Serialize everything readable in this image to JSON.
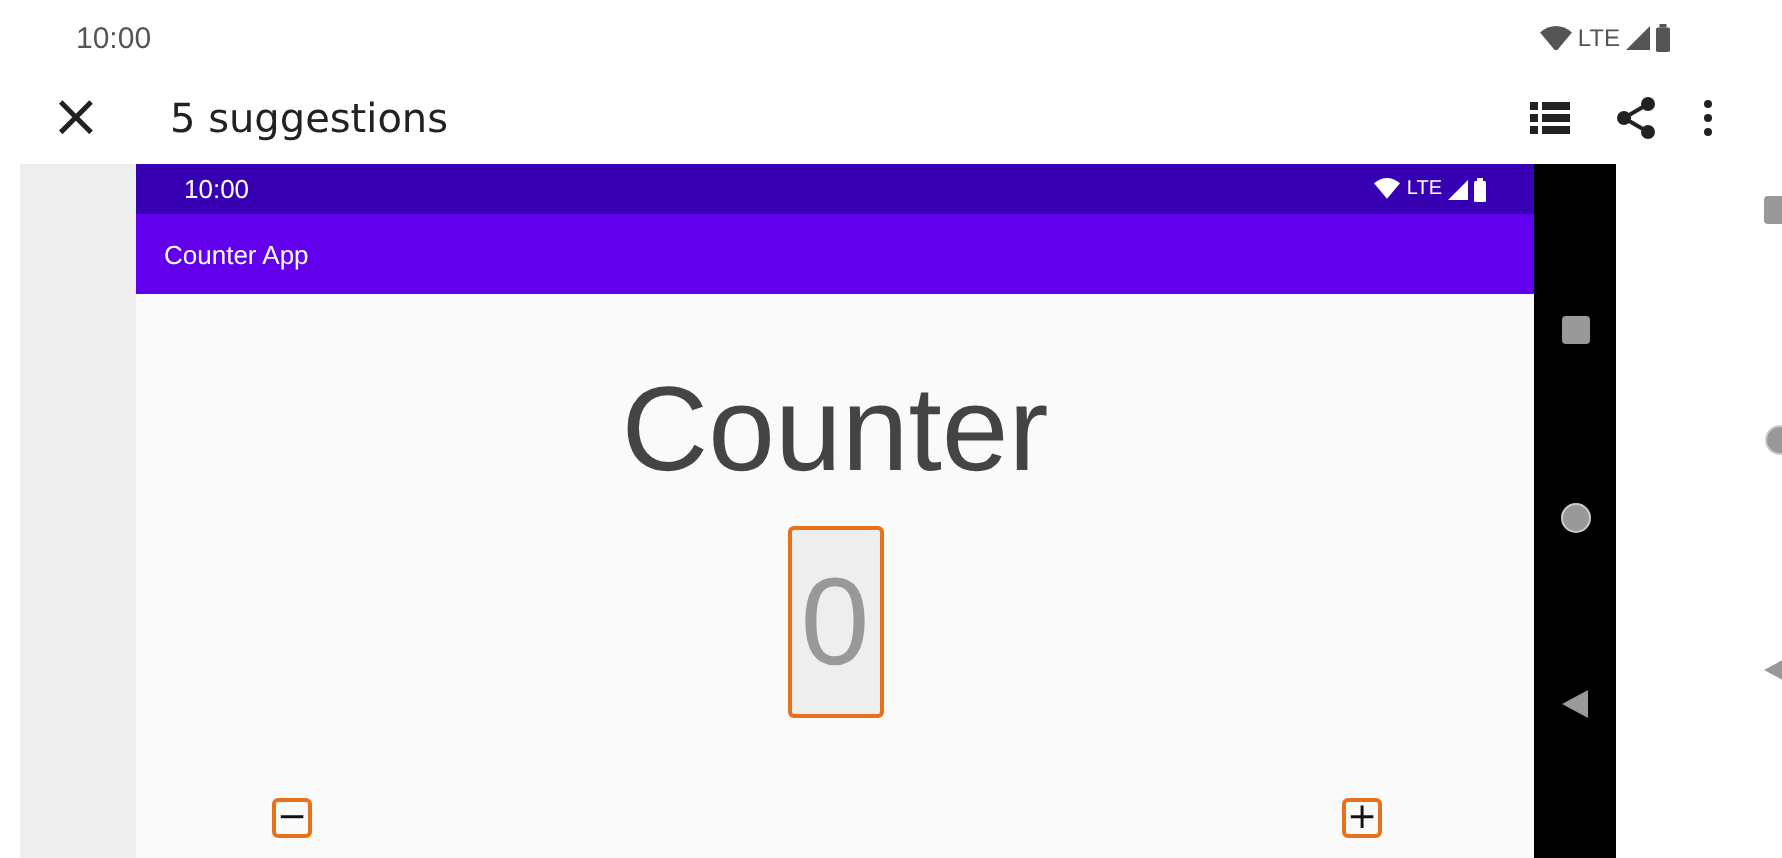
{
  "status_bar": {
    "time": "10:00",
    "network": "LTE"
  },
  "app_bar": {
    "close": "×",
    "title": "5 suggestions"
  },
  "screenshot": {
    "status_bar": {
      "time": "10:00",
      "network": "LTE"
    },
    "toolbar": {
      "title": "Counter App"
    },
    "heading": "Counter",
    "counter_value": "0",
    "buttons": [
      {
        "kind": "decrement",
        "label": "−"
      },
      {
        "kind": "increment",
        "label": "+"
      }
    ]
  }
}
